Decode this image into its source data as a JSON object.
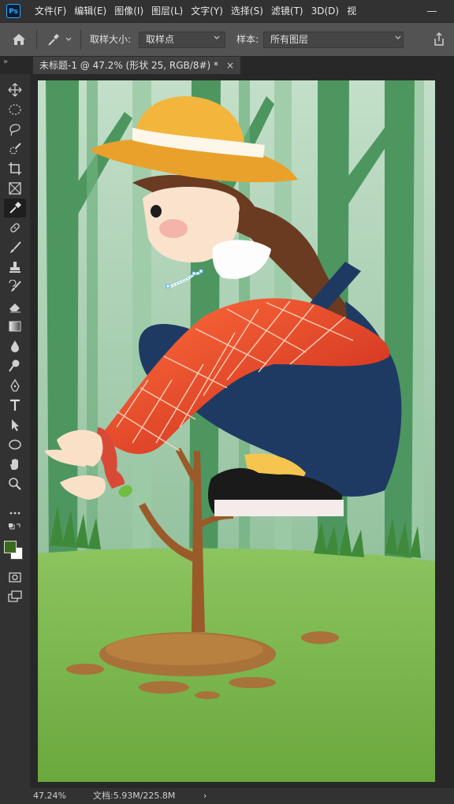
{
  "app": {
    "logo": "Ps"
  },
  "menu": [
    "文件(F)",
    "编辑(E)",
    "图像(I)",
    "图层(L)",
    "文字(Y)",
    "选择(S)",
    "滤镜(T)",
    "3D(D)",
    "视"
  ],
  "options": {
    "sample_size_label": "取样大小:",
    "sample_size_value": "取样点",
    "sample_label": "样本:",
    "sample_value": "所有图层"
  },
  "tab": {
    "title": "未标题-1 @ 47.2% (形状 25, RGB/8#) *",
    "close": "×"
  },
  "toolbar_icons": [
    "move-icon",
    "marquee-icon",
    "lasso-icon",
    "quick-select-icon",
    "crop-icon",
    "frame-icon",
    "eyedropper-icon",
    "healing-icon",
    "brush-icon",
    "stamp-icon",
    "history-brush-icon",
    "eraser-icon",
    "gradient-icon",
    "blur-icon",
    "dodge-icon",
    "pen-icon",
    "type-icon",
    "path-select-icon",
    "shape-icon",
    "hand-icon",
    "zoom-icon",
    "more-tools-icon"
  ],
  "colors": {
    "foreground": "#3a6a1e",
    "background": "#ffffff",
    "accent": "#31a8ff"
  },
  "status": {
    "zoom": "47.24%",
    "doc": "文档:5.93M/225.8M",
    "arrow": "›"
  }
}
